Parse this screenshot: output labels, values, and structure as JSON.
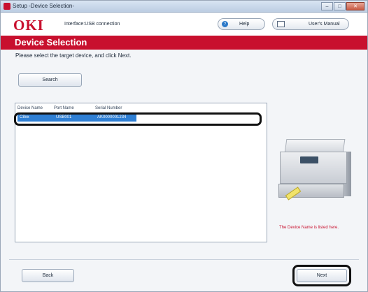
{
  "window": {
    "title": "Setup -Device Selection-",
    "controls": [
      "–",
      "□",
      "✕"
    ]
  },
  "header": {
    "logo": "OKI",
    "connection": "Interface:USB connection",
    "help_label": "Help",
    "manual_label": "User's Manual"
  },
  "banner": {
    "title": "Device Selection"
  },
  "main": {
    "instruction": "Please select the target device, and click Next.",
    "search_label": "Search",
    "device_list": {
      "columns": [
        "Device Name",
        "Port Name",
        "Serial Number"
      ],
      "rows": [
        {
          "device_name": "C8xx",
          "port_name": "USB001",
          "serial_number": "AK0000001234"
        }
      ]
    },
    "device_note": "The Device Name is listed here."
  },
  "footer": {
    "back_label": "Back",
    "next_label": "Next"
  },
  "colors": {
    "brand_red": "#c8102e",
    "selection_blue": "#2f7fd4"
  }
}
